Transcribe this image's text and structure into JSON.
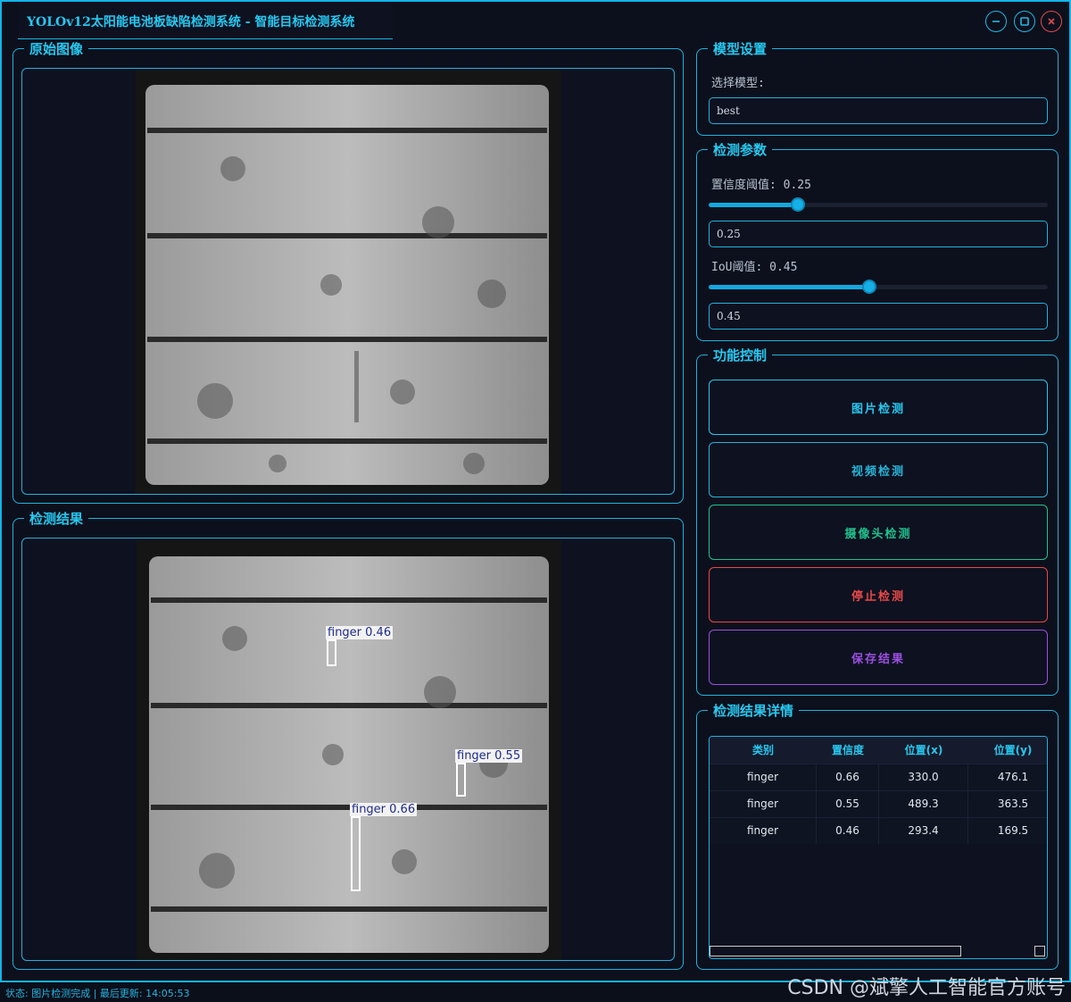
{
  "window": {
    "title": "YOLOv12太阳能电池板缺陷检测系统 - 智能目标检测系统",
    "minimize_icon": "minimize-icon",
    "maximize_icon": "maximize-icon",
    "close_icon": "close-icon"
  },
  "original_panel": {
    "title": "原始图像"
  },
  "result_panel": {
    "title": "检测结果",
    "detections": [
      {
        "label": "finger 0.46"
      },
      {
        "label": "finger 0.55"
      },
      {
        "label": "finger 0.66"
      }
    ]
  },
  "model_settings": {
    "title": "模型设置",
    "select_label": "选择模型:",
    "selected_model": "best"
  },
  "params": {
    "title": "检测参数",
    "confidence_label": "置信度阈值: 0.25",
    "confidence_value": "0.25",
    "confidence_fraction": 0.25,
    "iou_label": "IoU阈值: 0.45",
    "iou_value": "0.45",
    "iou_fraction": 0.45
  },
  "controls": {
    "title": "功能控制",
    "image_detect": "图片检测",
    "video_detect": "视频检测",
    "camera_detect": "摄像头检测",
    "stop_detect": "停止检测",
    "save_result": "保存结果",
    "colors": {
      "image": "#27c8f0",
      "video": "#27b4d8",
      "camera": "#20c08c",
      "stop": "#e84848",
      "save": "#9b4fe0"
    }
  },
  "details": {
    "title": "检测结果详情",
    "headers": [
      "类别",
      "置信度",
      "位置(x)",
      "位置(y)"
    ],
    "rows": [
      [
        "finger",
        "0.66",
        "330.0",
        "476.1"
      ],
      [
        "finger",
        "0.55",
        "489.3",
        "363.5"
      ],
      [
        "finger",
        "0.46",
        "293.4",
        "169.5"
      ]
    ]
  },
  "status": {
    "text": "状态: 图片检测完成 | 最后更新: 14:05:53"
  },
  "watermark": "CSDN @斌擎人工智能官方账号"
}
